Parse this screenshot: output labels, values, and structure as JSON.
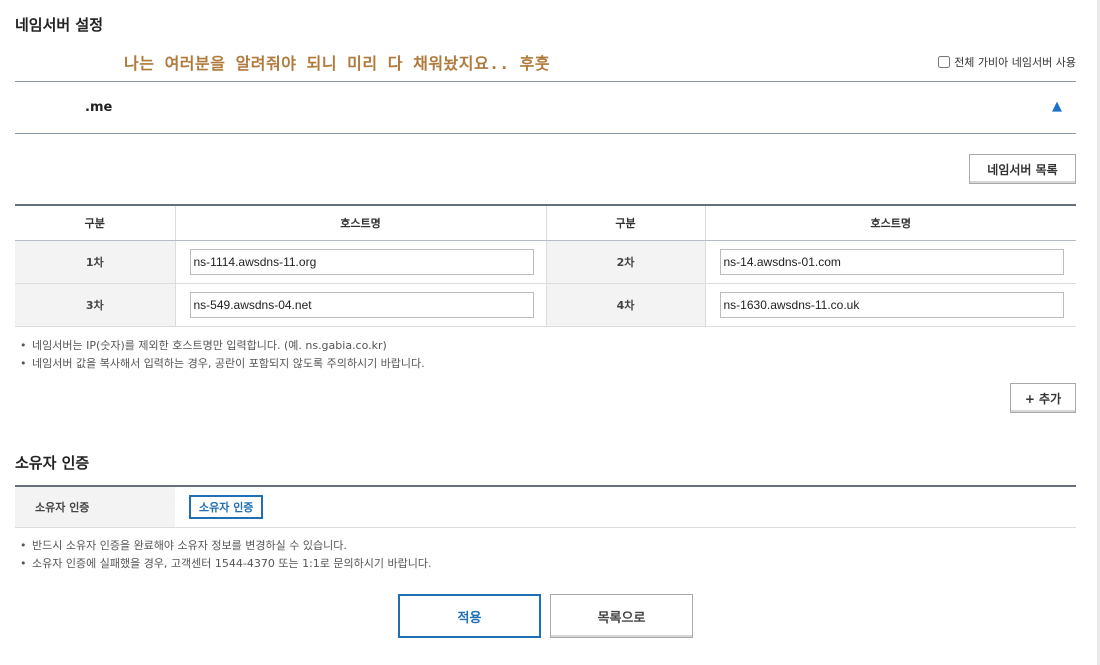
{
  "section_title": "네임서버 설정",
  "overlay_note": "나는 여러분을 알려줘야 되니 미리 다 채워놨지요.. 후훗",
  "all_ns_checkbox": {
    "label": "전체 가비아 네임서버 사용",
    "checked": false
  },
  "domain": {
    "name": ".me",
    "toggle_icon": "triangle-up-icon",
    "toggle_glyph": "▲"
  },
  "ns_list_button": "네임서버 목록",
  "ns_table": {
    "headers": [
      "구분",
      "호스트명",
      "구분",
      "호스트명"
    ],
    "rows": [
      {
        "label1": "1차",
        "host1": "ns-1114.awsdns-11.org",
        "label2": "2차",
        "host2": "ns-14.awsdns-01.com"
      },
      {
        "label1": "3차",
        "host1": "ns-549.awsdns-04.net",
        "label2": "4차",
        "host2": "ns-1630.awsdns-11.co.uk"
      }
    ]
  },
  "ns_notes": [
    "네임서버는 IP(숫자)를 제외한 호스트명만 입력합니다. (예. ns.gabia.co.kr)",
    "네임서버 값을 복사해서 입력하는 경우, 공란이 포함되지 않도록 주의하시기 바랍니다."
  ],
  "add_button": "+ 추가",
  "owner": {
    "title": "소유자 인증",
    "label": "소유자 인증",
    "verify_button": "소유자 인증",
    "notes": [
      "반드시 소유자 인증을 완료해야 소유자 정보를 변경하실 수 있습니다.",
      "소유자 인증에 실패했을 경우, 고객센터 1544-4370 또는 1:1로 문의하시기 바랍니다."
    ]
  },
  "actions": {
    "apply": "적용",
    "back_to_list": "목록으로"
  },
  "colors": {
    "accent": "#1f6fb5",
    "note_text": "#b07a3c",
    "table_rule": "#66707a"
  }
}
